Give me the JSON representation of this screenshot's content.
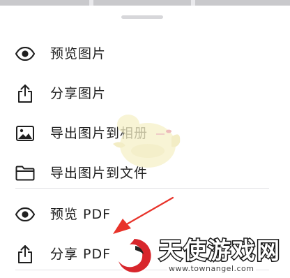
{
  "sheet": {
    "items": [
      {
        "label": "预览图片",
        "icon": "eye-icon"
      },
      {
        "label": "分享图片",
        "icon": "share-icon"
      },
      {
        "label": "导出图片到相册",
        "icon": "image-icon"
      },
      {
        "label": "导出图片到文件",
        "icon": "folder-icon"
      },
      {
        "label": "预览 PDF",
        "icon": "eye-icon"
      },
      {
        "label": "分享 PDF",
        "icon": "share-icon"
      }
    ]
  },
  "watermark": {
    "title": "天使游戏网",
    "url": "www.townangel.com"
  },
  "colors": {
    "text": "#1f1f1f",
    "divider": "#e3e3e6",
    "arrow": "#e8332a",
    "handle": "#d7d7da"
  }
}
